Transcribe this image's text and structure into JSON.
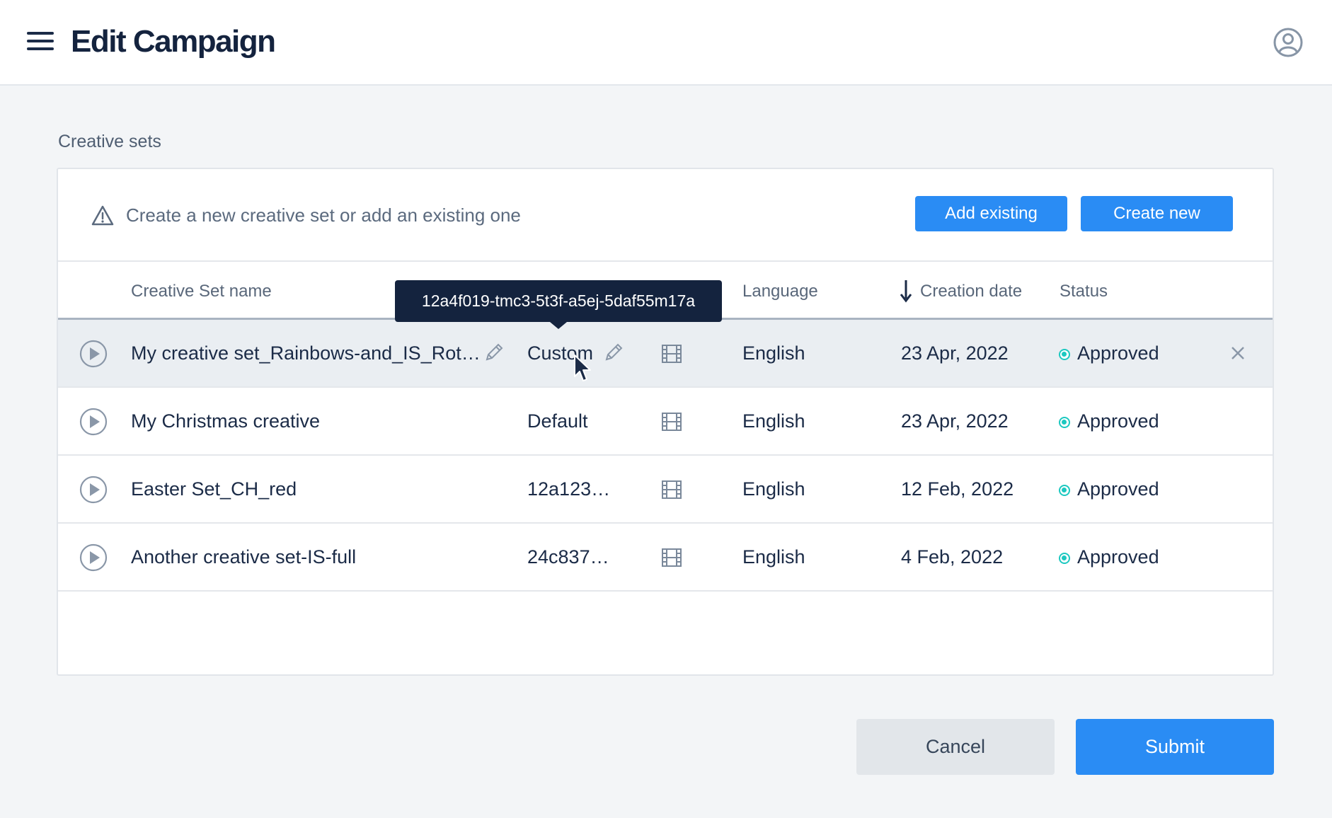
{
  "header": {
    "title": "Edit Campaign",
    "menu_icon": "hamburger-menu-icon",
    "user_icon": "user-circle-icon"
  },
  "section": {
    "title": "Creative sets"
  },
  "notice": {
    "text": "Create a new creative set or add an existing one",
    "icon": "warning-triangle-icon"
  },
  "buttons": {
    "add_existing": "Add existing",
    "create_new": "Create new",
    "cancel": "Cancel",
    "submit": "Submit"
  },
  "table": {
    "columns": {
      "name": "Creative Set name",
      "language": "Language",
      "creation_date": "Creation date",
      "status": "Status"
    },
    "rows": [
      {
        "name": "My creative set_Rainbows-and_IS_Rot…",
        "variant": "Custom",
        "language": "English",
        "date": "23 Apr, 2022",
        "status": "Approved"
      },
      {
        "name": "My Christmas creative",
        "variant": "Default",
        "language": "English",
        "date": "23 Apr, 2022",
        "status": "Approved"
      },
      {
        "name": "Easter Set_CH_red",
        "variant": "12a123…",
        "language": "English",
        "date": "12 Feb, 2022",
        "status": "Approved"
      },
      {
        "name": "Another creative set-IS-full",
        "variant": "24c837…",
        "language": "English",
        "date": "4 Feb, 2022",
        "status": "Approved"
      }
    ]
  },
  "tooltip": {
    "text": "12a4f019-tmc3-5t3f-a5ej-5daf55m17a"
  },
  "colors": {
    "accent": "#2a8cf4",
    "status_approved": "#1cc8c0",
    "title": "#14233e",
    "tooltip_bg": "#14233e"
  }
}
